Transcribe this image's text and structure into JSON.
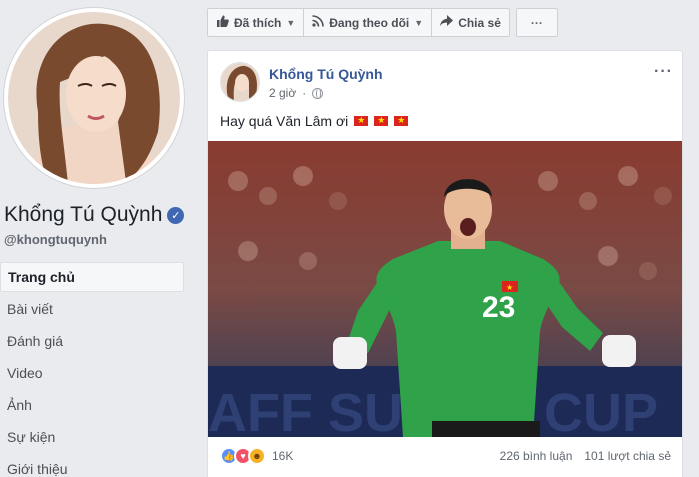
{
  "profile": {
    "name": "Khổng Tú Quỳnh",
    "handle": "@khongtuquynh"
  },
  "nav": {
    "items": [
      {
        "label": "Trang chủ"
      },
      {
        "label": "Bài viết"
      },
      {
        "label": "Đánh giá"
      },
      {
        "label": "Video"
      },
      {
        "label": "Ảnh"
      },
      {
        "label": "Sự kiện"
      },
      {
        "label": "Giới thiệu"
      }
    ]
  },
  "actions": {
    "liked": "Đã thích",
    "following": "Đang theo dõi",
    "share": "Chia sẻ",
    "more": "···"
  },
  "post": {
    "author": "Khổng Tú Quỳnh",
    "time": "2 giờ",
    "text": "Hay quá Văn Lâm ơi",
    "flags": 3,
    "jersey_number": "23",
    "reaction_count": "16K",
    "comments": "226 bình luận",
    "shares": "101 lượt chia sẻ",
    "menu": "···"
  },
  "colors": {
    "accent": "#4267b2",
    "author": "#365899",
    "background": "#e9ebee"
  }
}
